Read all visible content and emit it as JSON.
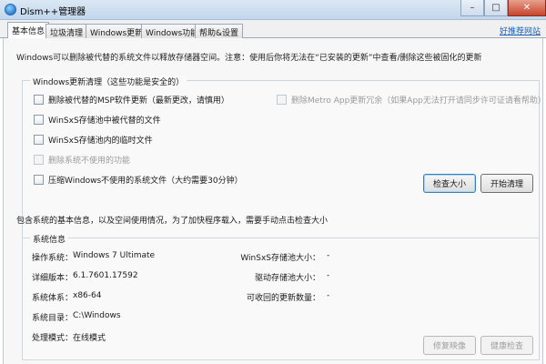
{
  "window": {
    "title": "Dism++管理器"
  },
  "tabs": [
    "基本信息",
    "垃圾清理",
    "Windows更新",
    "Windows功能",
    "帮助&设置"
  ],
  "top_link": "好推荐网站",
  "notice": "Windows可以删除被代替的系统文件以释放存储器空间。注意：使用后你将无法在“已安装的更新”中查看/删除这些被固化的更新",
  "update_cleanup": {
    "title": "Windows更新清理（这些功能是安全的）",
    "options": [
      {
        "label": "删除被代替的MSP软件更新（最新更改，请慎用）",
        "checked": false,
        "enabled": true
      },
      {
        "label": "WinSxS存储池中被代替的文件",
        "checked": false,
        "enabled": true
      },
      {
        "label": "WinSxS存储池内的临时文件",
        "checked": false,
        "enabled": true
      },
      {
        "label": "删除系统不使用的功能",
        "checked": false,
        "enabled": false
      },
      {
        "label": "压缩Windows不使用的系统文件（大约需要30分钟）",
        "checked": false,
        "enabled": true
      },
      {
        "label": "删除Metro App更新冗余（如果App无法打开请同步许可证请看帮助）",
        "checked": false,
        "enabled": false
      }
    ],
    "check_size_button": "检查大小",
    "start_cleanup_button": "开始清理"
  },
  "info_text": "包含系统的基本信息，以及空间使用情况，为了加快程序载入，需要手动点击检查大小",
  "system_info": {
    "title": "系统信息",
    "os_label": "操作系统：",
    "os_value": "Windows 7 Ultimate",
    "version_label": "详细版本：",
    "version_value": "6.1.7601.17592",
    "arch_label": "系统体系：",
    "arch_value": "x86-64",
    "dir_label": "系统目录：",
    "dir_value": "C:\\Windows",
    "mode_label": "处理模式：",
    "mode_value": "在线模式",
    "winsxs_label": "WinSxS存储池大小：",
    "winsxs_value": "-",
    "driver_label": "驱动存储池大小：",
    "driver_value": "-",
    "reclaim_label": "可收回的更新数量：",
    "reclaim_value": "-",
    "repair_button": "修复映像",
    "health_button": "健康检查"
  },
  "colors": {
    "link": "#1a5fb4",
    "disabled_text": "#9a9a9a",
    "titlebar": "#c3d6ec"
  }
}
